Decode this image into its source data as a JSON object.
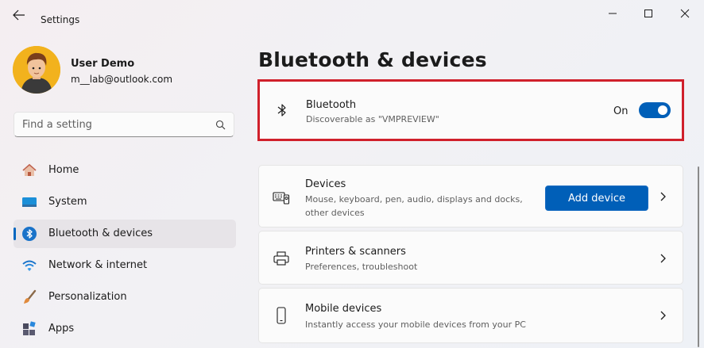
{
  "window": {
    "title": "Settings"
  },
  "profile": {
    "name": "User Demo",
    "email": "m__lab@outlook.com"
  },
  "search": {
    "placeholder": "Find a setting"
  },
  "nav": {
    "items": [
      {
        "label": "Home",
        "icon": "home-icon"
      },
      {
        "label": "System",
        "icon": "system-icon"
      },
      {
        "label": "Bluetooth & devices",
        "icon": "bluetooth-icon",
        "selected": true
      },
      {
        "label": "Network & internet",
        "icon": "wifi-icon"
      },
      {
        "label": "Personalization",
        "icon": "brush-icon"
      },
      {
        "label": "Apps",
        "icon": "apps-icon"
      }
    ]
  },
  "main": {
    "title": "Bluetooth & devices",
    "bluetooth": {
      "title": "Bluetooth",
      "subtitle": "Discoverable as \"VMPREVIEW\"",
      "toggle_label": "On",
      "toggle_on": true
    },
    "cards": [
      {
        "title": "Devices",
        "subtitle": "Mouse, keyboard, pen, audio, displays and docks, other devices",
        "button": "Add device",
        "icon": "devices-icon"
      },
      {
        "title": "Printers & scanners",
        "subtitle": "Preferences, troubleshoot",
        "icon": "printer-icon"
      },
      {
        "title": "Mobile devices",
        "subtitle": "Instantly access your mobile devices from your PC",
        "icon": "phone-icon"
      }
    ]
  },
  "colors": {
    "accent": "#005fb8",
    "highlight": "#d0202b",
    "selected_bg": "#e7e4e8"
  }
}
